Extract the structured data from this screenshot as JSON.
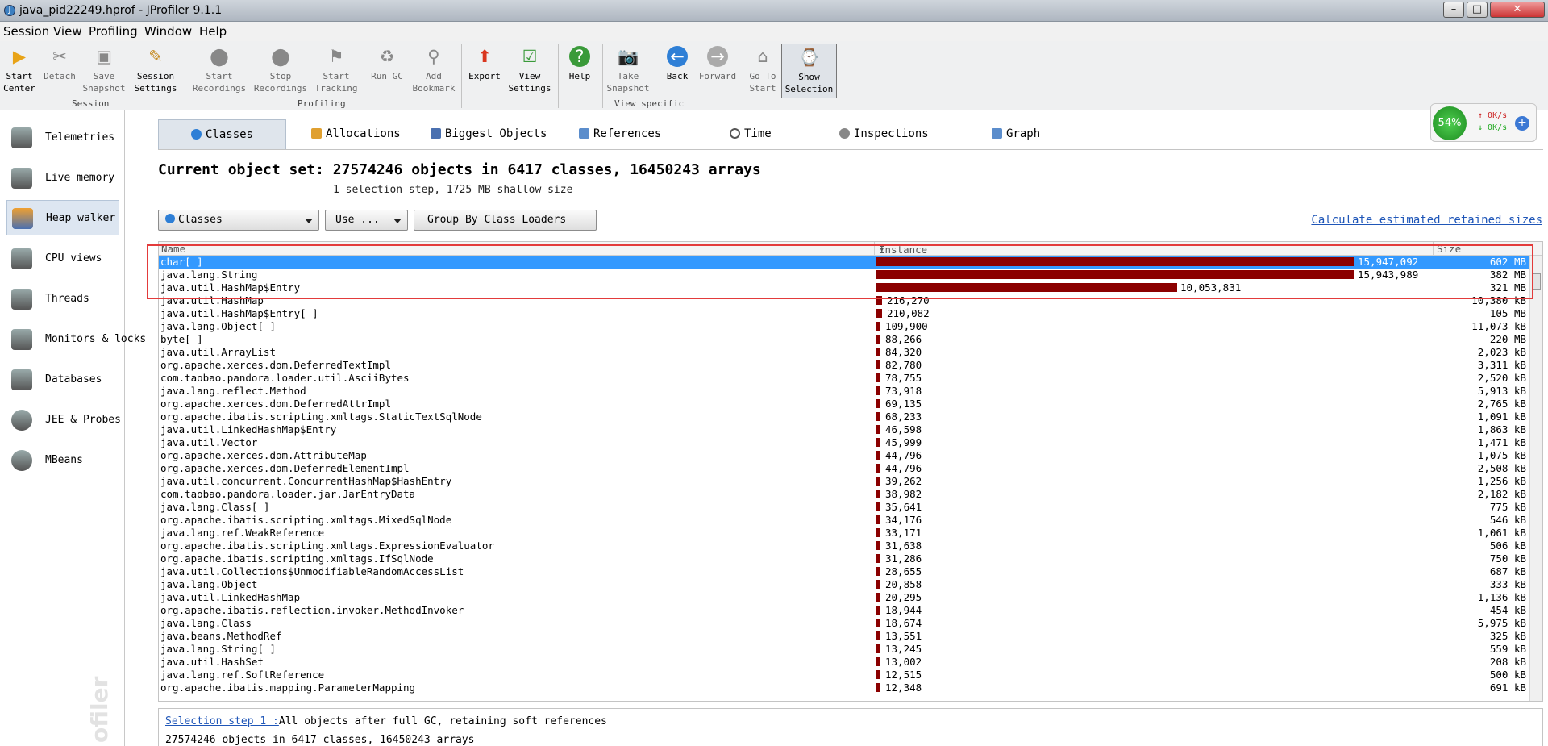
{
  "window": {
    "title": "java_pid22249.hprof - JProfiler 9.1.1"
  },
  "menu": [
    "Session",
    "View",
    "Profiling",
    "Window",
    "Help"
  ],
  "toolbar": {
    "buttons": [
      {
        "label1": "Start",
        "label2": "Center",
        "icon": "start-center-icon"
      },
      {
        "label1": "",
        "label2": "Detach",
        "icon": "detach-icon"
      },
      {
        "label1": "Save",
        "label2": "Snapshot",
        "icon": "save-snapshot-icon"
      },
      {
        "label1": "Session",
        "label2": "Settings",
        "icon": "session-settings-icon"
      },
      {
        "label1": "Start",
        "label2": "Recordings",
        "icon": "start-recordings-icon"
      },
      {
        "label1": "Stop",
        "label2": "Recordings",
        "icon": "stop-recordings-icon"
      },
      {
        "label1": "Start",
        "label2": "Tracking",
        "icon": "start-tracking-icon"
      },
      {
        "label1": "",
        "label2": "Run GC",
        "icon": "run-gc-icon"
      },
      {
        "label1": "Add",
        "label2": "Bookmark",
        "icon": "add-bookmark-icon"
      },
      {
        "label1": "",
        "label2": "Export",
        "icon": "export-icon"
      },
      {
        "label1": "View",
        "label2": "Settings",
        "icon": "view-settings-icon"
      },
      {
        "label1": "",
        "label2": "Help",
        "icon": "help-icon"
      },
      {
        "label1": "Take",
        "label2": "Snapshot",
        "icon": "take-snapshot-icon"
      },
      {
        "label1": "",
        "label2": "Back",
        "icon": "back-icon"
      },
      {
        "label1": "",
        "label2": "Forward",
        "icon": "forward-icon"
      },
      {
        "label1": "Go To",
        "label2": "Start",
        "icon": "go-to-start-icon"
      },
      {
        "label1": "Show",
        "label2": "Selection",
        "icon": "show-selection-icon"
      }
    ],
    "groups": [
      "Session",
      "Profiling",
      "View specific"
    ]
  },
  "perf": {
    "cpu": "54%",
    "up": "0K/s",
    "down": "0K/s"
  },
  "sidebar": [
    {
      "label": "Telemetries",
      "icon": "telemetries-icon"
    },
    {
      "label": "Live memory",
      "icon": "live-memory-icon"
    },
    {
      "label": "Heap walker",
      "icon": "heap-walker-icon"
    },
    {
      "label": "CPU views",
      "icon": "cpu-views-icon"
    },
    {
      "label": "Threads",
      "icon": "threads-icon"
    },
    {
      "label": "Monitors & locks",
      "icon": "monitors-locks-icon"
    },
    {
      "label": "Databases",
      "icon": "databases-icon"
    },
    {
      "label": "JEE & Probes",
      "icon": "jee-probes-icon"
    },
    {
      "label": "MBeans",
      "icon": "mbeans-icon"
    }
  ],
  "watermark": "ofiler",
  "tabs": [
    {
      "label": "Classes",
      "icon": "classes-icon"
    },
    {
      "label": "Allocations",
      "icon": "allocations-icon"
    },
    {
      "label": "Biggest Objects",
      "icon": "biggest-objects-icon"
    },
    {
      "label": "References",
      "icon": "references-icon"
    },
    {
      "label": "Time",
      "icon": "time-icon"
    },
    {
      "label": "Inspections",
      "icon": "inspections-icon"
    },
    {
      "label": "Graph",
      "icon": "graph-icon"
    }
  ],
  "header": {
    "title": "Current object set: 27574246 objects in 6417 classes, 16450243 arrays",
    "subtitle": "1 selection step, 1725 MB shallow size"
  },
  "controls": {
    "view_select": "Classes",
    "use_button": "Use ...",
    "group_button": "Group By Class Loaders",
    "calc_link": "Calculate estimated retained sizes"
  },
  "table": {
    "columns": [
      "Name",
      "Instance count",
      "Size"
    ],
    "max_count": 15947092,
    "rows": [
      {
        "name": "char[ ]",
        "count": 15947092,
        "count_text": "15,947,092",
        "size": "602 MB",
        "selected": true
      },
      {
        "name": "java.lang.String",
        "count": 15943989,
        "count_text": "15,943,989",
        "size": "382 MB"
      },
      {
        "name": "java.util.HashMap$Entry",
        "count": 10053831,
        "count_text": "10,053,831",
        "size": "321 MB"
      },
      {
        "name": "java.util.HashMap",
        "count": 216270,
        "count_text": "216,270",
        "size": "10,380 kB"
      },
      {
        "name": "java.util.HashMap$Entry[ ]",
        "count": 210082,
        "count_text": "210,082",
        "size": "105 MB"
      },
      {
        "name": "java.lang.Object[ ]",
        "count": 109900,
        "count_text": "109,900",
        "size": "11,073 kB"
      },
      {
        "name": "byte[ ]",
        "count": 88266,
        "count_text": "88,266",
        "size": "220 MB"
      },
      {
        "name": "java.util.ArrayList",
        "count": 84320,
        "count_text": "84,320",
        "size": "2,023 kB"
      },
      {
        "name": "org.apache.xerces.dom.DeferredTextImpl",
        "count": 82780,
        "count_text": "82,780",
        "size": "3,311 kB"
      },
      {
        "name": "com.taobao.pandora.loader.util.AsciiBytes",
        "count": 78755,
        "count_text": "78,755",
        "size": "2,520 kB"
      },
      {
        "name": "java.lang.reflect.Method",
        "count": 73918,
        "count_text": "73,918",
        "size": "5,913 kB"
      },
      {
        "name": "org.apache.xerces.dom.DeferredAttrImpl",
        "count": 69135,
        "count_text": "69,135",
        "size": "2,765 kB"
      },
      {
        "name": "org.apache.ibatis.scripting.xmltags.StaticTextSqlNode",
        "count": 68233,
        "count_text": "68,233",
        "size": "1,091 kB"
      },
      {
        "name": "java.util.LinkedHashMap$Entry",
        "count": 46598,
        "count_text": "46,598",
        "size": "1,863 kB"
      },
      {
        "name": "java.util.Vector",
        "count": 45999,
        "count_text": "45,999",
        "size": "1,471 kB"
      },
      {
        "name": "org.apache.xerces.dom.AttributeMap",
        "count": 44796,
        "count_text": "44,796",
        "size": "1,075 kB"
      },
      {
        "name": "org.apache.xerces.dom.DeferredElementImpl",
        "count": 44796,
        "count_text": "44,796",
        "size": "2,508 kB"
      },
      {
        "name": "java.util.concurrent.ConcurrentHashMap$HashEntry",
        "count": 39262,
        "count_text": "39,262",
        "size": "1,256 kB"
      },
      {
        "name": "com.taobao.pandora.loader.jar.JarEntryData",
        "count": 38982,
        "count_text": "38,982",
        "size": "2,182 kB"
      },
      {
        "name": "java.lang.Class[ ]",
        "count": 35641,
        "count_text": "35,641",
        "size": "775 kB"
      },
      {
        "name": "org.apache.ibatis.scripting.xmltags.MixedSqlNode",
        "count": 34176,
        "count_text": "34,176",
        "size": "546 kB"
      },
      {
        "name": "java.lang.ref.WeakReference",
        "count": 33171,
        "count_text": "33,171",
        "size": "1,061 kB"
      },
      {
        "name": "org.apache.ibatis.scripting.xmltags.ExpressionEvaluator",
        "count": 31638,
        "count_text": "31,638",
        "size": "506 kB"
      },
      {
        "name": "org.apache.ibatis.scripting.xmltags.IfSqlNode",
        "count": 31286,
        "count_text": "31,286",
        "size": "750 kB"
      },
      {
        "name": "java.util.Collections$UnmodifiableRandomAccessList",
        "count": 28655,
        "count_text": "28,655",
        "size": "687 kB"
      },
      {
        "name": "java.lang.Object",
        "count": 20858,
        "count_text": "20,858",
        "size": "333 kB"
      },
      {
        "name": "java.util.LinkedHashMap",
        "count": 20295,
        "count_text": "20,295",
        "size": "1,136 kB"
      },
      {
        "name": "org.apache.ibatis.reflection.invoker.MethodInvoker",
        "count": 18944,
        "count_text": "18,944",
        "size": "454 kB"
      },
      {
        "name": "java.lang.Class",
        "count": 18674,
        "count_text": "18,674",
        "size": "5,975 kB"
      },
      {
        "name": "java.beans.MethodRef",
        "count": 13551,
        "count_text": "13,551",
        "size": "325 kB"
      },
      {
        "name": "java.lang.String[ ]",
        "count": 13245,
        "count_text": "13,245",
        "size": "559 kB"
      },
      {
        "name": "java.util.HashSet",
        "count": 13002,
        "count_text": "13,002",
        "size": "208 kB"
      },
      {
        "name": "java.lang.ref.SoftReference",
        "count": 12515,
        "count_text": "12,515",
        "size": "500 kB"
      },
      {
        "name": "org.apache.ibatis.mapping.ParameterMapping",
        "count": 12348,
        "count_text": "12,348",
        "size": "691 kB"
      }
    ]
  },
  "footer": {
    "step_link": "Selection step 1 :",
    "step_text": "All objects after full GC, retaining soft references",
    "summary": "27574246 objects in 6417 classes, 16450243 arrays"
  }
}
